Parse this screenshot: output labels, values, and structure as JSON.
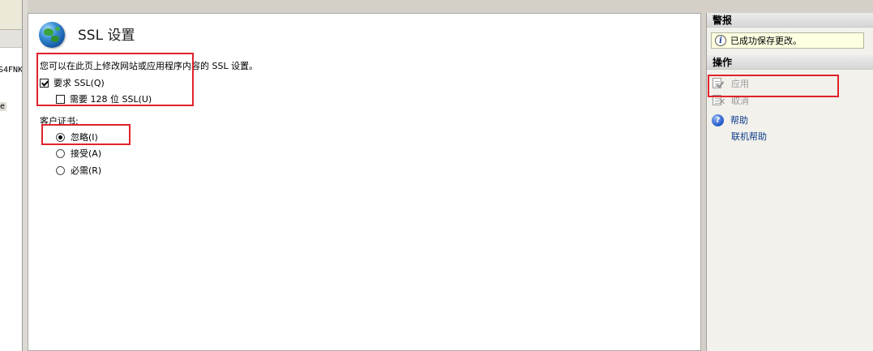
{
  "left_pane": {
    "node_1_text": "S4FNK",
    "node_2_text": "e"
  },
  "main": {
    "title": "SSL 设置",
    "description": "您可以在此页上修改网站或应用程序内容的 SSL 设置。",
    "require_ssl": {
      "label": "要求 SSL(Q)",
      "checked": true
    },
    "require_128": {
      "label": "需要 128 位 SSL(U)",
      "checked": false
    },
    "client_cert_label": "客户证书:",
    "client_cert_options": [
      {
        "label": "忽略(I)",
        "selected": true
      },
      {
        "label": "接受(A)",
        "selected": false
      },
      {
        "label": "必需(R)",
        "selected": false
      }
    ]
  },
  "right_pane": {
    "alerts_header": "警报",
    "alert_message": "已成功保存更改。",
    "actions_header": "操作",
    "actions": {
      "apply": "应用",
      "cancel": "取消",
      "help": "帮助",
      "online_help": "联机帮助"
    }
  },
  "colors": {
    "highlight_box": "#e0222a",
    "alert_background": "#ffffe1",
    "link": "#0b3a8a"
  }
}
